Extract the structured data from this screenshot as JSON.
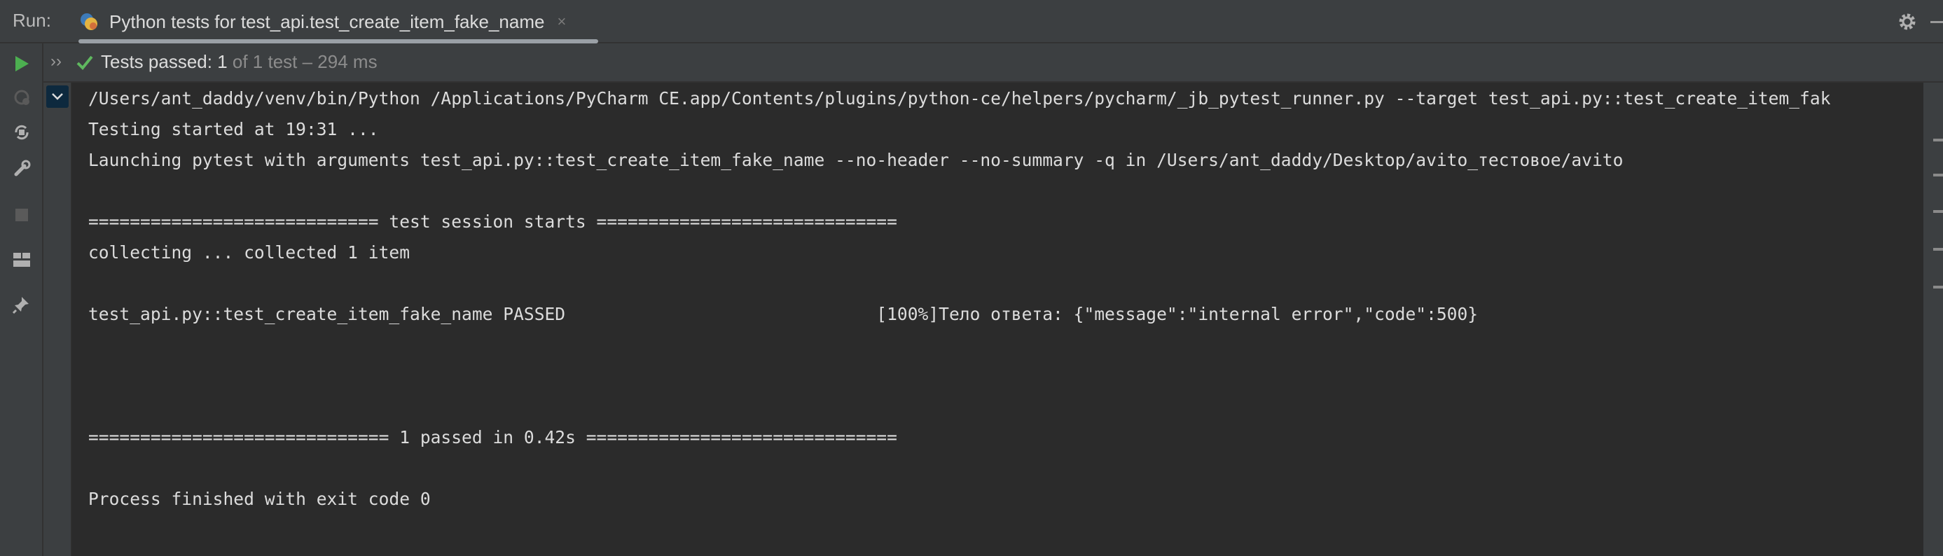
{
  "header": {
    "run_label": "Run:",
    "tab_title": "Python tests for test_api.test_create_item_fake_name",
    "tab_close": "×"
  },
  "toolbar": {
    "tools": [
      "rerun-icon",
      "rerun-failed-icon",
      "toggle-auto-test-icon",
      "settings-wrench-icon",
      "stop-icon",
      "layout-icon",
      "pin-icon"
    ]
  },
  "status": {
    "expand_glyph": "››",
    "passed_label": "Tests passed: ",
    "passed_count": "1",
    "detail": " of 1 test – 294 ms"
  },
  "console": {
    "lines": [
      "/Users/ant_daddy/venv/bin/Python /Applications/PyCharm CE.app/Contents/plugins/python-ce/helpers/pycharm/_jb_pytest_runner.py --target test_api.py::test_create_item_fak",
      "Testing started at 19:31 ...",
      "Launching pytest with arguments test_api.py::test_create_item_fake_name --no-header --no-summary -q in /Users/ant_daddy/Desktop/avito_тестовое/avito",
      "============================ test session starts =============================",
      "collecting ... collected 1 item",
      "test_api.py::test_create_item_fake_name PASSED                              [100%]Тело ответа: {\"message\":\"internal error\",\"code\":500}",
      "============================= 1 passed in 0.42s ==============================",
      "Process finished with exit code 0"
    ]
  },
  "colors": {
    "background": "#2b2b2b",
    "panel": "#3c3f41",
    "text": "#dcdcdc",
    "run_green": "#4caf50",
    "check_green": "#5fb85f",
    "selection": "#0d293e"
  }
}
